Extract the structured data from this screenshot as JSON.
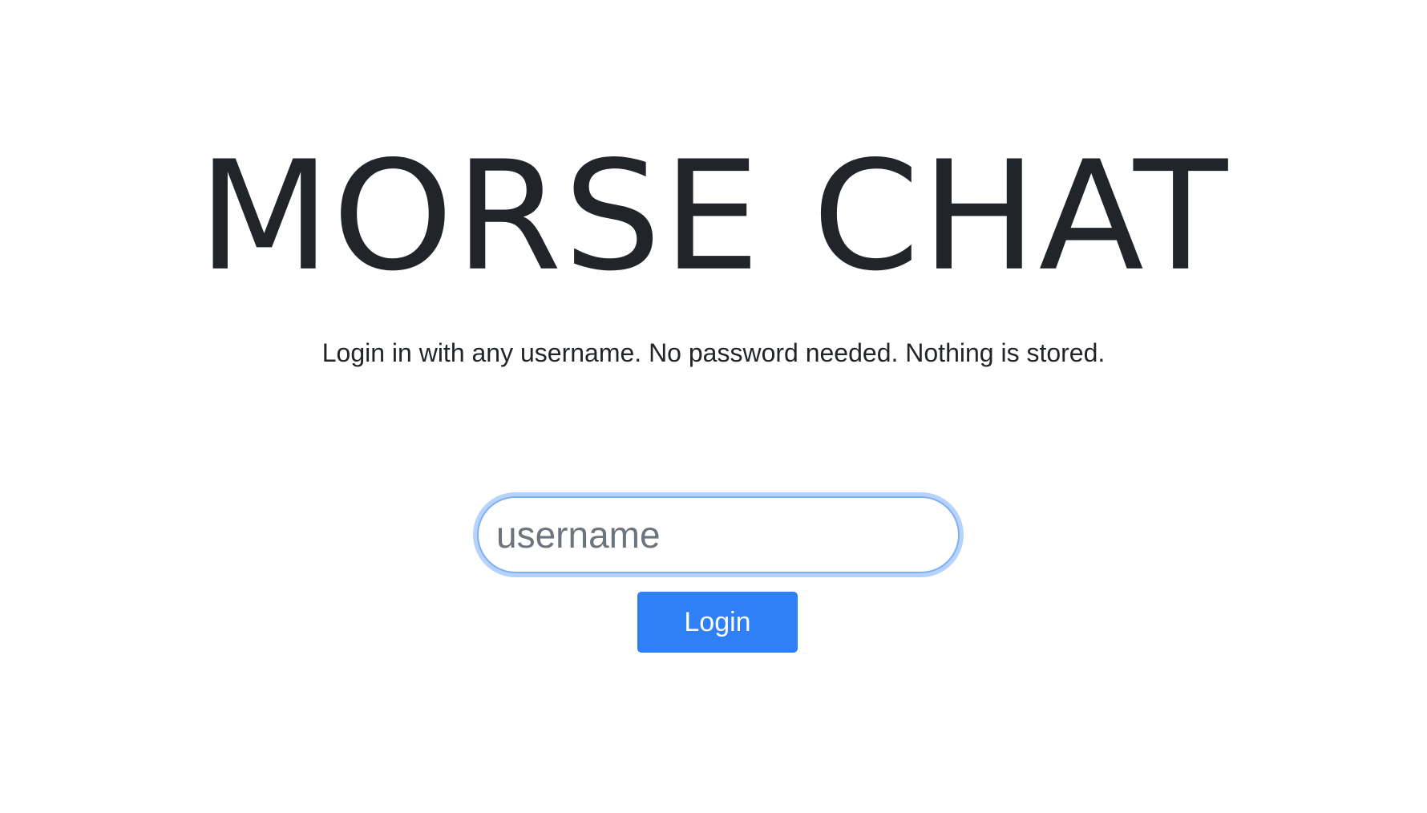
{
  "app": {
    "title": "MORSE CHAT",
    "subtitle": "Login in with any username. No password needed. Nothing is stored."
  },
  "login_form": {
    "username_value": "",
    "username_placeholder": "username",
    "login_label": "Login"
  },
  "colors": {
    "text": "#212529",
    "placeholder": "#6c757d",
    "focus_ring": "#b8d3fb",
    "input_border": "#7fb0f2",
    "button_bg": "#2f80f7",
    "button_text": "#ffffff",
    "background": "#ffffff"
  }
}
